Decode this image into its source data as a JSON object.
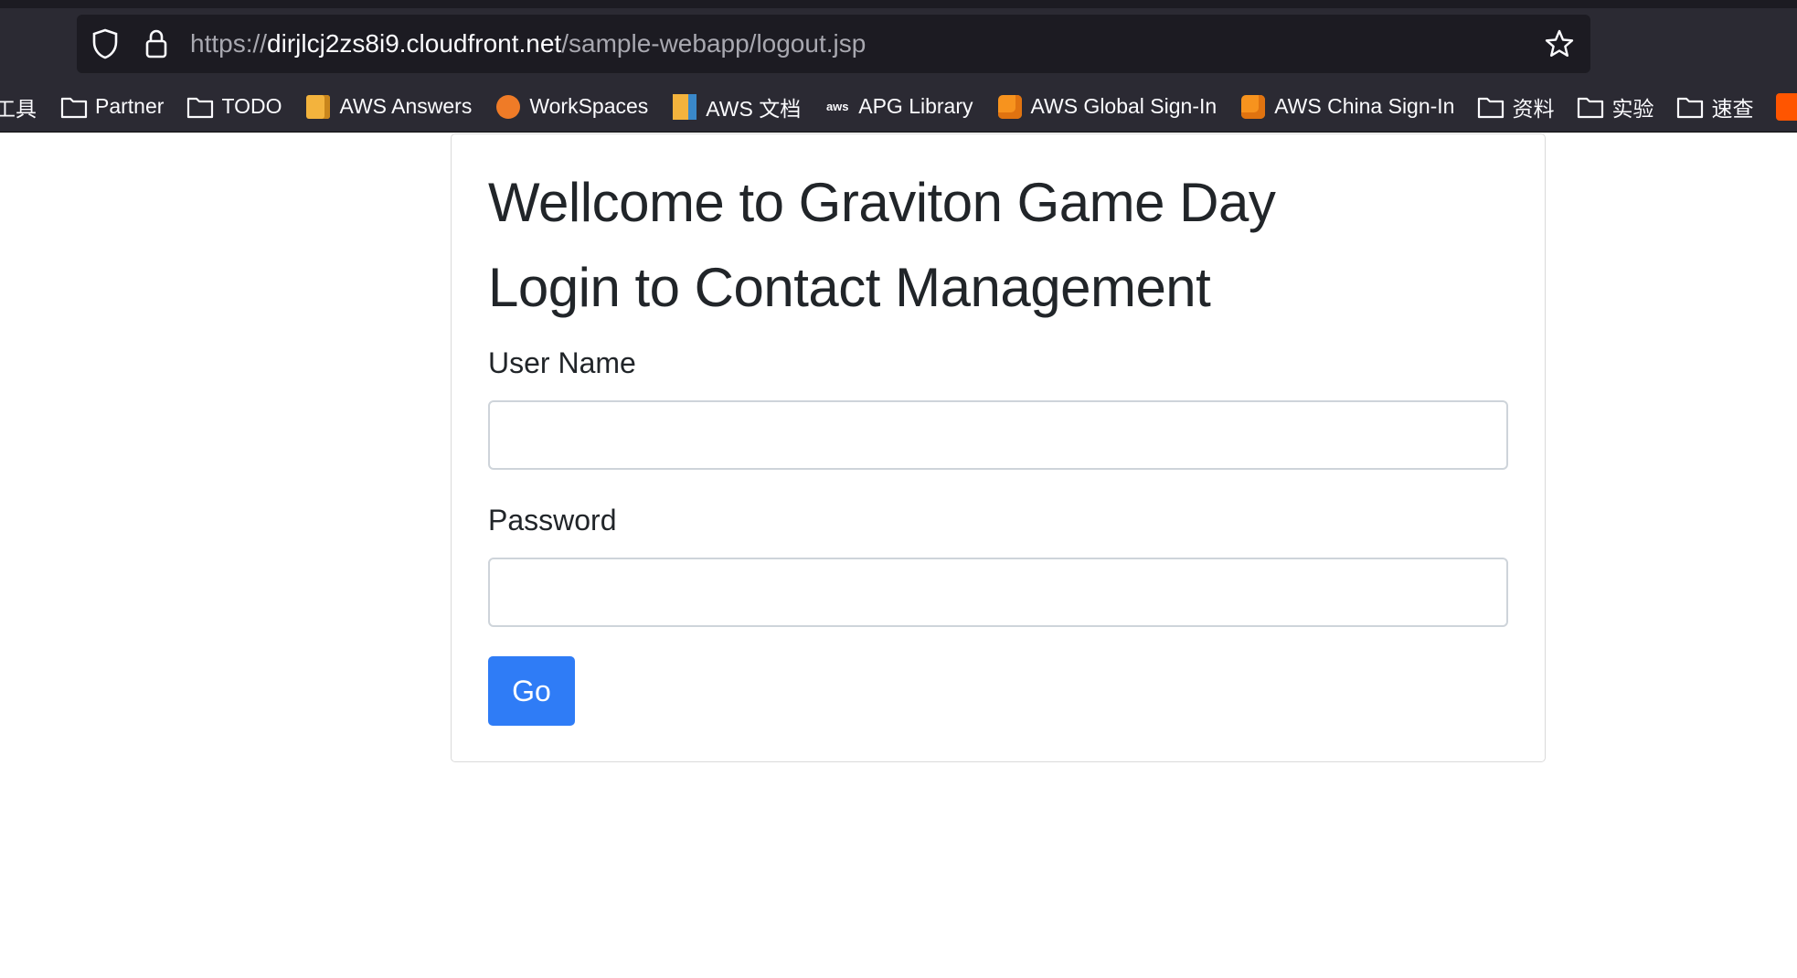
{
  "browser": {
    "url_scheme": "https://",
    "url_host": "dirjlcj2zs8i9.cloudfront.net",
    "url_path": "/sample-webapp/logout.jsp",
    "bookmarks": [
      {
        "label": "工具",
        "icon": "folder-icon"
      },
      {
        "label": "Partner",
        "icon": "folder-icon"
      },
      {
        "label": "TODO",
        "icon": "folder-icon"
      },
      {
        "label": "AWS Answers",
        "icon": "box-icon"
      },
      {
        "label": "WorkSpaces",
        "icon": "workspaces-icon"
      },
      {
        "label": "AWS 文档",
        "icon": "docs-icon"
      },
      {
        "label": "APG Library",
        "icon": "aws-logo-icon",
        "icon_text": "aws"
      },
      {
        "label": "AWS Global Sign-In",
        "icon": "aws-cube-icon"
      },
      {
        "label": "AWS China Sign-In",
        "icon": "aws-cube-icon"
      },
      {
        "label": "资料",
        "icon": "folder-icon"
      },
      {
        "label": "实验",
        "icon": "folder-icon"
      },
      {
        "label": "速查",
        "icon": "folder-icon"
      },
      {
        "label": "",
        "icon": "cloud-icon"
      }
    ]
  },
  "page": {
    "title": "Wellcome to Graviton Game Day",
    "subtitle": "Login to Contact Management",
    "username_label": "User Name",
    "username_value": "",
    "password_label": "Password",
    "password_value": "",
    "submit_label": "Go"
  },
  "colors": {
    "chrome_bg": "#2b2a33",
    "urlbar_bg": "#1c1b22",
    "button_bg": "#2f7cf6",
    "text": "#212529"
  }
}
